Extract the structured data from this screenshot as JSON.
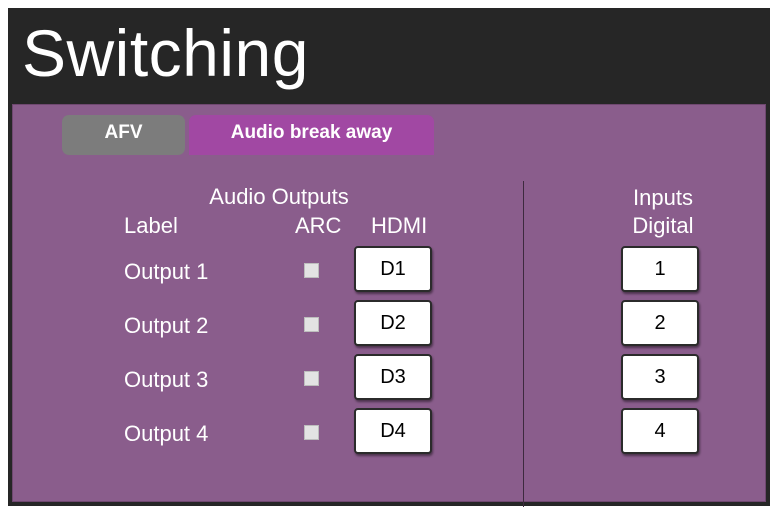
{
  "header": {
    "title": "Switching"
  },
  "tabs": [
    {
      "label": "AFV",
      "active": false
    },
    {
      "label": "Audio break away",
      "active": true
    }
  ],
  "audio_outputs": {
    "heading": "Audio Outputs",
    "columns": {
      "label": "Label",
      "arc": "ARC",
      "hdmi": "HDMI"
    },
    "rows": [
      {
        "label": "Output 1",
        "arc_checked": false,
        "hdmi": "D1"
      },
      {
        "label": "Output 2",
        "arc_checked": false,
        "hdmi": "D2"
      },
      {
        "label": "Output 3",
        "arc_checked": false,
        "hdmi": "D3"
      },
      {
        "label": "Output 4",
        "arc_checked": false,
        "hdmi": "D4"
      }
    ]
  },
  "inputs": {
    "heading": "Inputs",
    "subheading": "Digital",
    "buttons": [
      "1",
      "2",
      "3",
      "4"
    ]
  },
  "colors": {
    "header_bg": "#262626",
    "panel_bg": "#8a5d8c",
    "tab_active": "#a148a3",
    "tab_inactive": "#7c7c7c"
  }
}
